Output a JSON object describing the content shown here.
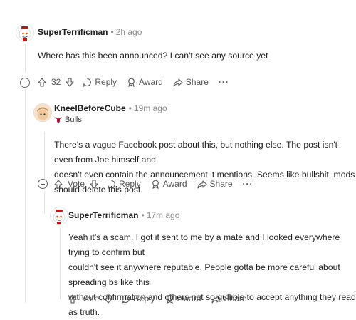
{
  "comments": [
    {
      "username": "SuperTerrificman",
      "time": "2h ago",
      "body": [
        "Where has this been announced? I can't see any source yet"
      ],
      "votes": "32"
    },
    {
      "username": "KneelBeforeCube",
      "time": "19m ago",
      "flair": "Bulls",
      "body": [
        "There's a vague Facebook post about this, but nothing else. The post isn't even from Joe himself and",
        "doesn't even contain the announcement it mentions. Seems like bullshit, mods should delete this post."
      ],
      "votes": "Vote"
    },
    {
      "username": "SuperTerrificman",
      "time": "17m ago",
      "body": [
        "Yeah it's a scam. I got it sent to me by a mate and I looked everywhere trying to confirm but",
        "couldn't see it anywhere reputable. People gotta be more careful about spreading bs like this",
        "without confirmation and others not so gullible to accept anything they read as truth."
      ],
      "votes": "Vote"
    }
  ],
  "actions": {
    "reply": "Reply",
    "award": "Award",
    "share": "Share",
    "more": "···"
  },
  "colors": {
    "meta": "#8a8a8a",
    "line": "#e3e3e3",
    "flair_icon": "#ce1141"
  }
}
